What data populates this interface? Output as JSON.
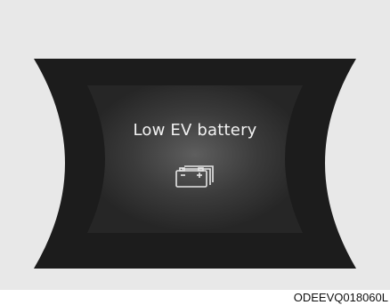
{
  "warning": {
    "message": "Low EV battery",
    "icon": "ev-battery-icon"
  },
  "colors": {
    "panel_background": "#e8e8e8",
    "display_dark": "#1f1f1f",
    "display_center": "#5a5a5a",
    "text": "#f2f2f2"
  },
  "figure": {
    "code": "ODEEVQ018060L"
  }
}
